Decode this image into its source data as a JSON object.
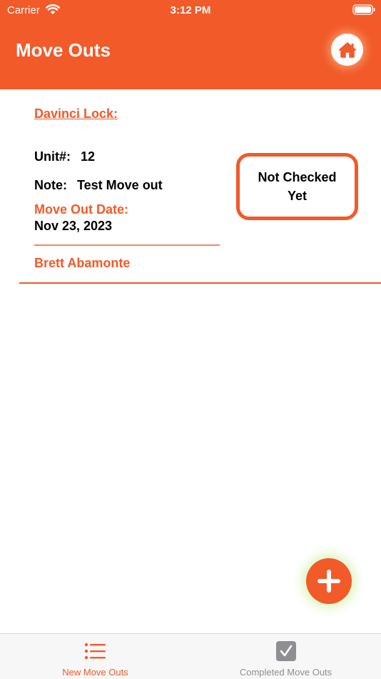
{
  "status_bar": {
    "carrier": "Carrier",
    "time": "3:12 PM"
  },
  "header": {
    "title": "Move Outs"
  },
  "move_out": {
    "lock_name": "Davinci Lock:",
    "unit_label": "Unit#:",
    "unit_value": "12",
    "note_label": "Note:",
    "note_value": "Test Move out",
    "date_label": "Move Out Date:",
    "date_value": "Nov 23, 2023",
    "tenant": "Brett Abamonte",
    "status": "Not Checked Yet"
  },
  "tabs": [
    {
      "label": "New Move Outs",
      "icon": "list-icon",
      "active": true
    },
    {
      "label": "Completed Move Outs",
      "icon": "checkbox-icon",
      "active": false
    }
  ],
  "colors": {
    "accent": "#f25a29",
    "inactive": "#8e8e93"
  }
}
